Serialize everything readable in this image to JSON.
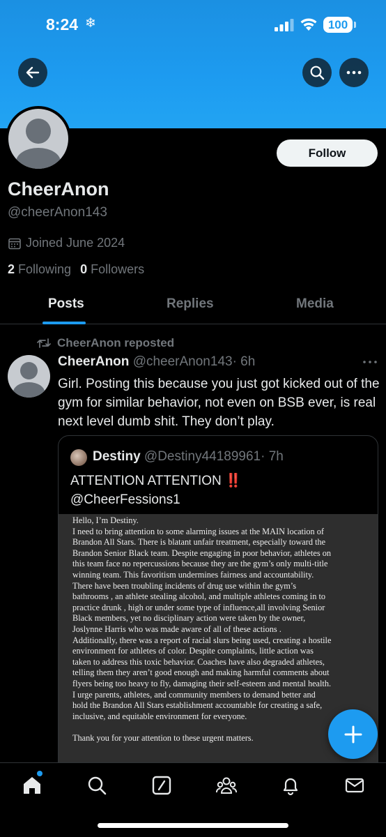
{
  "status_bar": {
    "time": "8:24",
    "snow_icon": "❄",
    "battery": "100"
  },
  "colors": {
    "accent": "#1d9bf0",
    "background": "#000000",
    "text": "#e7e9ea",
    "muted": "#71767b"
  },
  "profile": {
    "name": "CheerAnon",
    "handle": "@cheerAnon143",
    "joined": "Joined June 2024",
    "following_count": "2",
    "following_label": "Following",
    "followers_count": "0",
    "followers_label": "Followers",
    "follow_label": "Follow"
  },
  "tabs": [
    {
      "label": "Posts"
    },
    {
      "label": "Replies"
    },
    {
      "label": "Media"
    }
  ],
  "post": {
    "repost_label": "CheerAnon reposted",
    "author_name": "CheerAnon",
    "author_handle": "@cheerAnon143",
    "time": "· 6h",
    "text": "Girl. Posting this because you just got kicked out of the gym for similar behavior, not even on BSB ever, is real next level dumb shit. They don’t play.",
    "quote": {
      "author_name": "Destiny",
      "author_handle": "@Destiny44189961",
      "time": "· 7h",
      "text_line1": "ATTENTION ATTENTION ",
      "exclamation": "‼️",
      "text_line2": "@CheerFessions1",
      "document_lines": [
        "Hello, I’m Destiny.",
        "I need to bring attention to some alarming issues at the MAIN location of",
        "Brandon All Stars. There is blatant unfair treatment, especially toward the",
        "Brandon Senior Black team. Despite engaging in poor behavior, athletes on",
        "this team face no repercussions because they are the gym’s only multi-title",
        "winning team. This favoritism undermines fairness and accountability.",
        "There have been troubling incidents of drug use within the gym’s",
        "bathrooms , an athlete stealing alcohol, and multiple athletes coming in to",
        "practice drunk , high or under some type of influence,all involving Senior",
        "Black members, yet no disciplinary action were taken by the owner,",
        "Joslynne Harris who was made aware of all of these actions .",
        "Additionally, there was a report of racial slurs being used, creating a hostile",
        "environment for athletes of color. Despite complaints, little action was",
        "taken to address this toxic behavior. Coaches have also degraded athletes,",
        "telling them they aren’t good enough and making harmful comments about",
        "flyers being too heavy to fly, damaging their self-esteem and mental health.",
        "I urge parents, athletes, and community members to demand better and",
        "hold the Brandon All Stars establishment accountable for creating a safe,",
        "inclusive, and equitable environment for everyone.",
        "",
        "Thank you for your attention to these urgent matters."
      ]
    }
  },
  "fab": {
    "icon": "plus-icon",
    "label": "+"
  },
  "bottom_nav": [
    {
      "icon": "home-icon",
      "has_notification_dot": true
    },
    {
      "icon": "search-icon"
    },
    {
      "icon": "grok-icon"
    },
    {
      "icon": "communities-icon"
    },
    {
      "icon": "bell-icon"
    },
    {
      "icon": "mail-icon"
    }
  ]
}
